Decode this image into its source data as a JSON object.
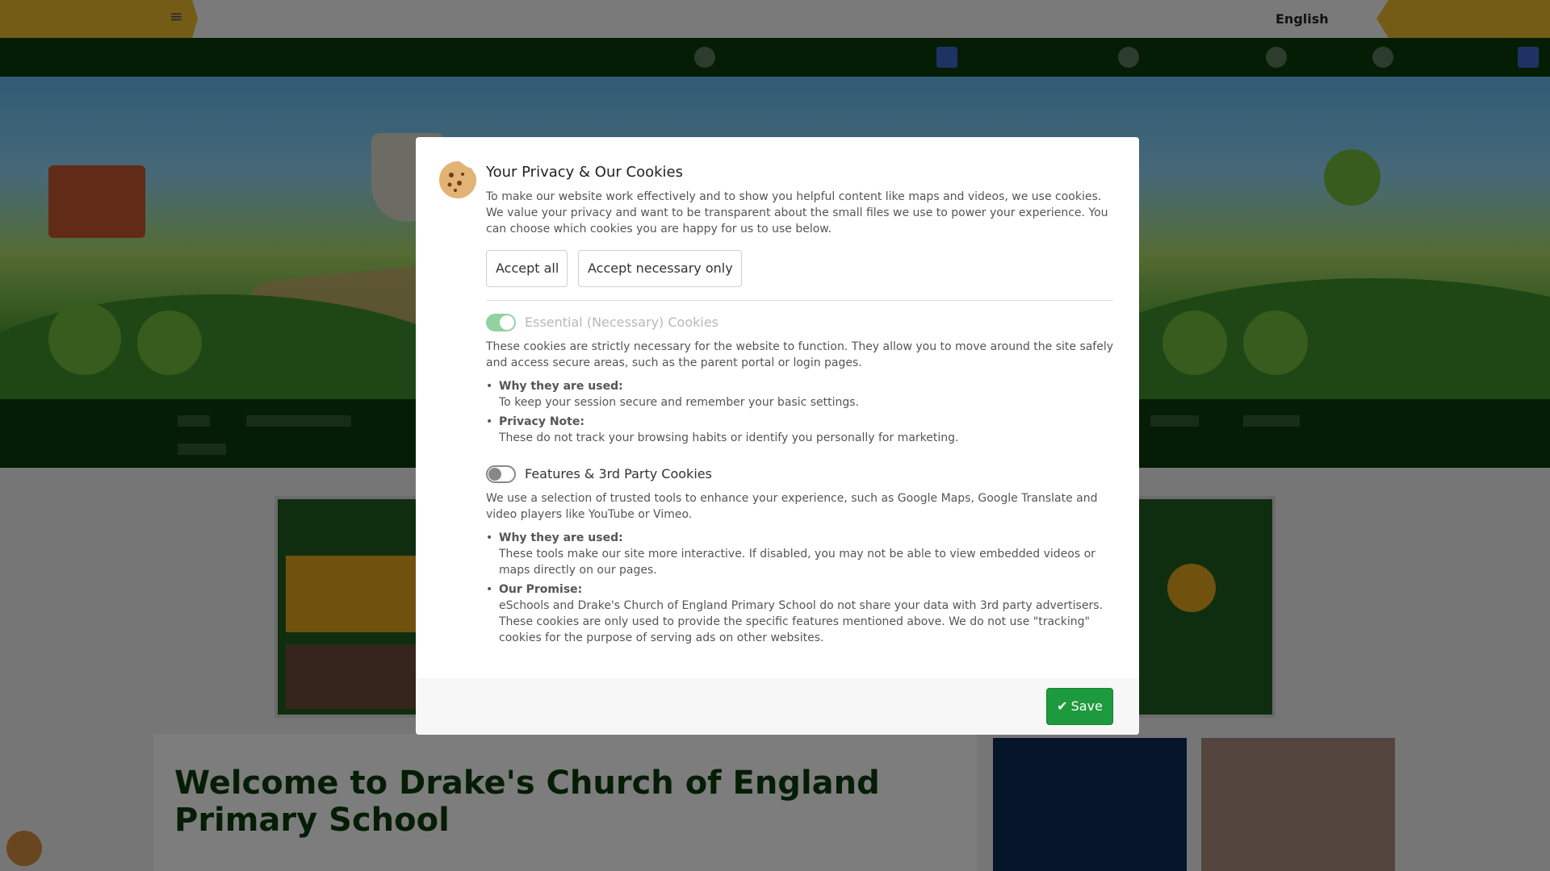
{
  "background": {
    "language_selector": "English",
    "welcome_heading": "Welcome to Drake's Church of England Primary School"
  },
  "modal": {
    "title": "Your Privacy & Our Cookies",
    "intro": "To make our website work effectively and to show you helpful content like maps and videos, we use cookies. We value your privacy and want to be transparent about the small files we use to power your experience. You can choose which cookies you are happy for us to use below.",
    "accept_all_label": "Accept all",
    "accept_necessary_label": "Accept necessary only",
    "sections": [
      {
        "title": "Essential (Necessary) Cookies",
        "enabled": true,
        "locked": true,
        "description": "These cookies are strictly necessary for the website to function. They allow you to move around the site safely and access secure areas, such as the parent portal or login pages.",
        "bullets": [
          {
            "heading": "Why they are used:",
            "text": "To keep your session secure and remember your basic settings."
          },
          {
            "heading": "Privacy Note:",
            "text": "These do not track your browsing habits or identify you personally for marketing."
          }
        ]
      },
      {
        "title": "Features & 3rd Party Cookies",
        "enabled": false,
        "locked": false,
        "description": "We use a selection of trusted tools to enhance your experience, such as Google Maps, Google Translate and video players like YouTube or Vimeo.",
        "bullets": [
          {
            "heading": "Why they are used:",
            "text": "These tools make our site more interactive. If disabled, you may not be able to view embedded videos or maps directly on our pages."
          },
          {
            "heading": "Our Promise:",
            "text": "eSchools and Drake's Church of England Primary School do not share your data with 3rd party advertisers. These cookies are only used to provide the specific features mentioned above. We do not use \"tracking\" cookies for the purpose of serving ads on other websites."
          }
        ]
      }
    ],
    "save_label": "Save",
    "icons": {
      "header": "cookie-icon",
      "save": "check-icon"
    },
    "colors": {
      "save_button": "#1e9a3e",
      "toggle_on": "#28a745",
      "overlay": "rgba(0,0,0,0.5)"
    }
  }
}
